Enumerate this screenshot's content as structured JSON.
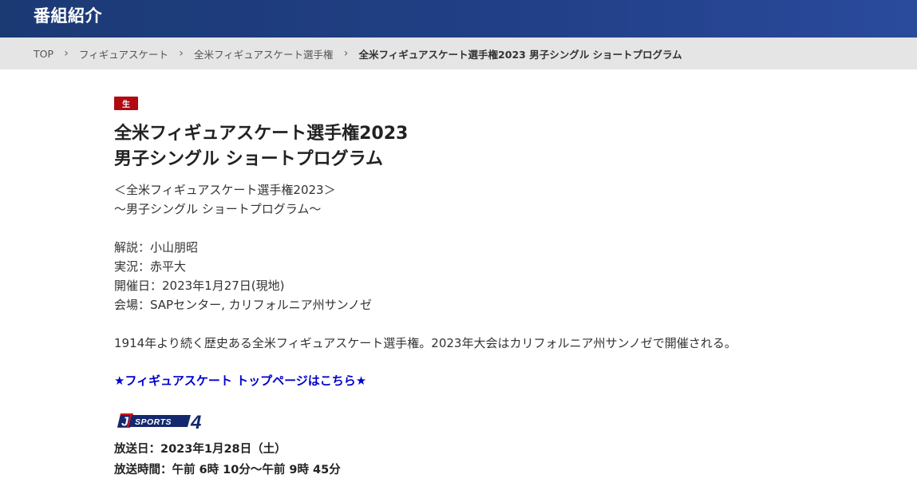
{
  "header": {
    "title": "番組紹介"
  },
  "breadcrumb": {
    "items": [
      {
        "label": "TOP"
      },
      {
        "label": "フィギュアスケート"
      },
      {
        "label": "全米フィギュアスケート選手権"
      },
      {
        "label": "全米フィギュアスケート選手権2023 男子シングル ショートプログラム"
      }
    ]
  },
  "program": {
    "badge": "生",
    "title_line1": "全米フィギュアスケート選手権2023",
    "title_line2": "男子シングル ショートプログラム",
    "subtitle_line1": "＜全米フィギュアスケート選手権2023＞",
    "subtitle_line2": "～男子シングル ショートプログラム～",
    "commentary": "解説：小山朋昭",
    "announcer": "実況：赤平大",
    "date": "開催日：2023年1月27日(現地)",
    "venue": "会場：SAPセンター, カリフォルニア州サンノゼ",
    "description": "1914年より続く歴史ある全米フィギュアスケート選手権。2023年大会はカリフォルニア州サンノゼで開催される。",
    "top_link": "★フィギュアスケート トップページはこちら★",
    "channel": {
      "letter": "J",
      "name": "SPORTS",
      "number": "4",
      "colors": {
        "navy": "#14286e",
        "red": "#d4141c"
      }
    },
    "broadcast_date": "放送日：2023年1月28日（土）",
    "broadcast_time": "放送時間：午前 6時 10分～午前 9時 45分"
  }
}
